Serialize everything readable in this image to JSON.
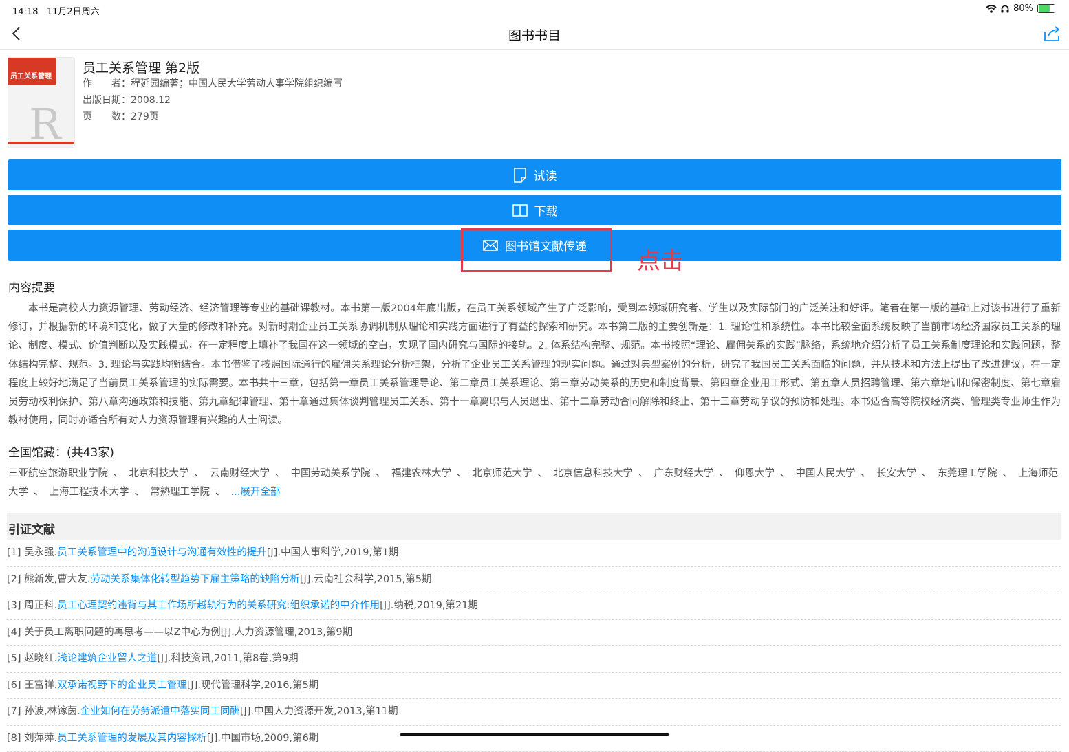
{
  "status": {
    "time": "14:18",
    "date": "11月2日周六",
    "battery": "80%",
    "battery_level": 0.8
  },
  "nav": {
    "title": "图书书目"
  },
  "book": {
    "cover_title": "员工关系管理",
    "title": "员工关系管理 第2版",
    "author_label": "作　　者：",
    "author": "程延园编著；中国人民大学劳动人事学院组织编写",
    "date_label": "出版日期：",
    "date": "2008.12",
    "pages_label": "页　　数：",
    "pages": "279页"
  },
  "buttons": {
    "read": "试读",
    "download": "下载",
    "deliver": "图书馆文献传递"
  },
  "annotation": "点击",
  "abstract": {
    "heading": "内容提要",
    "text": "本书是高校人力资源管理、劳动经济、经济管理等专业的基础课教材。本书第一版2004年底出版，在员工关系领域产生了广泛影响，受到本领域研究者、学生以及实际部门的广泛关注和好评。笔者在第一版的基础上对该书进行了重新修订，并根据新的环境和变化，做了大量的修改和补充。对新时期企业员工关系协调机制从理论和实践方面进行了有益的探索和研究。本书第二版的主要创新是：1. 理论性和系统性。本书比较全面系统反映了当前市场经济国家员工关系的理论、制度、模式、价值判断以及实践模式，在一定程度上填补了我国在这一领域的空白，实现了国内研究与国际的接轨。2. 体系结构完整、规范。本书按照“理论、雇佣关系的实践”脉络，系统地介绍分析了员工关系制度理论和实践问题，整体结构完整、规范。3. 理论与实践均衡结合。本书借鉴了按照国际通行的雇佣关系理论分析框架，分析了企业员工关系管理的现实问题。通过对典型案例的分析，研究了我国员工关系面临的问题，并从技术和方法上提出了改进建议，在一定程度上较好地满足了当前员工关系管理的实际需要。本书共十三章，包括第一章员工关系管理导论、第二章员工关系理论、第三章劳动关系的历史和制度背景、第四章企业用工形式、第五章人员招聘管理、第六章培训和保密制度、第七章雇员劳动权利保护、第八章沟通政策和技能、第九章纪律管理、第十章通过集体谈判管理员工关系、第十一章离职与人员退出、第十二章劳动合同解除和终止、第十三章劳动争议的预防和处理。本书适合高等院校经济类、管理类专业师生作为教材使用，同时亦适合所有对人力资源管理有兴趣的人士阅读。"
  },
  "holdings": {
    "heading": "全国馆藏：(共43家)",
    "libraries": [
      "三亚航空旅游职业学院",
      "北京科技大学",
      "云南财经大学",
      "中国劳动关系学院",
      "福建农林大学",
      "北京师范大学",
      "北京信息科技大学",
      "广东财经大学",
      "仰恩大学",
      "中国人民大学",
      "长安大学",
      "东莞理工学院",
      "上海师范大学",
      "上海工程技术大学",
      "常熟理工学院"
    ],
    "more": "...展开全部"
  },
  "references": {
    "heading": "引证文献",
    "items": [
      {
        "prefix": "[1] 吴永强.",
        "link": "员工关系管理中的沟通设计与沟通有效性的提升",
        "suffix": "[J].中国人事科学,2019,第1期"
      },
      {
        "prefix": "[2] 熊新发,曹大友.",
        "link": "劳动关系集体化转型趋势下雇主策略的缺陷分析",
        "suffix": "[J].云南社会科学,2015,第5期"
      },
      {
        "prefix": "[3] 周正科.",
        "link": "员工心理契约违背与其工作场所越轨行为的关系研究:组织承诺的中介作用",
        "suffix": "[J].纳税,2019,第21期"
      },
      {
        "prefix": "[4] 关于员工离职问题的再思考——以Z中心为例[J].人力资源管理,2013,第9期",
        "link": "",
        "suffix": ""
      },
      {
        "prefix": "[5] 赵晓红.",
        "link": "浅论建筑企业留人之道",
        "suffix": "[J].科技资讯,2011,第8卷,第9期"
      },
      {
        "prefix": "[6] 王富祥.",
        "link": "双承诺视野下的企业员工管理",
        "suffix": "[J].现代管理科学,2016,第5期"
      },
      {
        "prefix": "[7] 孙波,林镓茵.",
        "link": "企业如何在劳务派遣中落实同工同酬",
        "suffix": "[J].中国人力资源开发,2013,第11期"
      },
      {
        "prefix": "[8] 刘萍萍.",
        "link": "员工关系管理的发展及其内容探析",
        "suffix": "[J].中国市场,2009,第6期"
      }
    ]
  }
}
